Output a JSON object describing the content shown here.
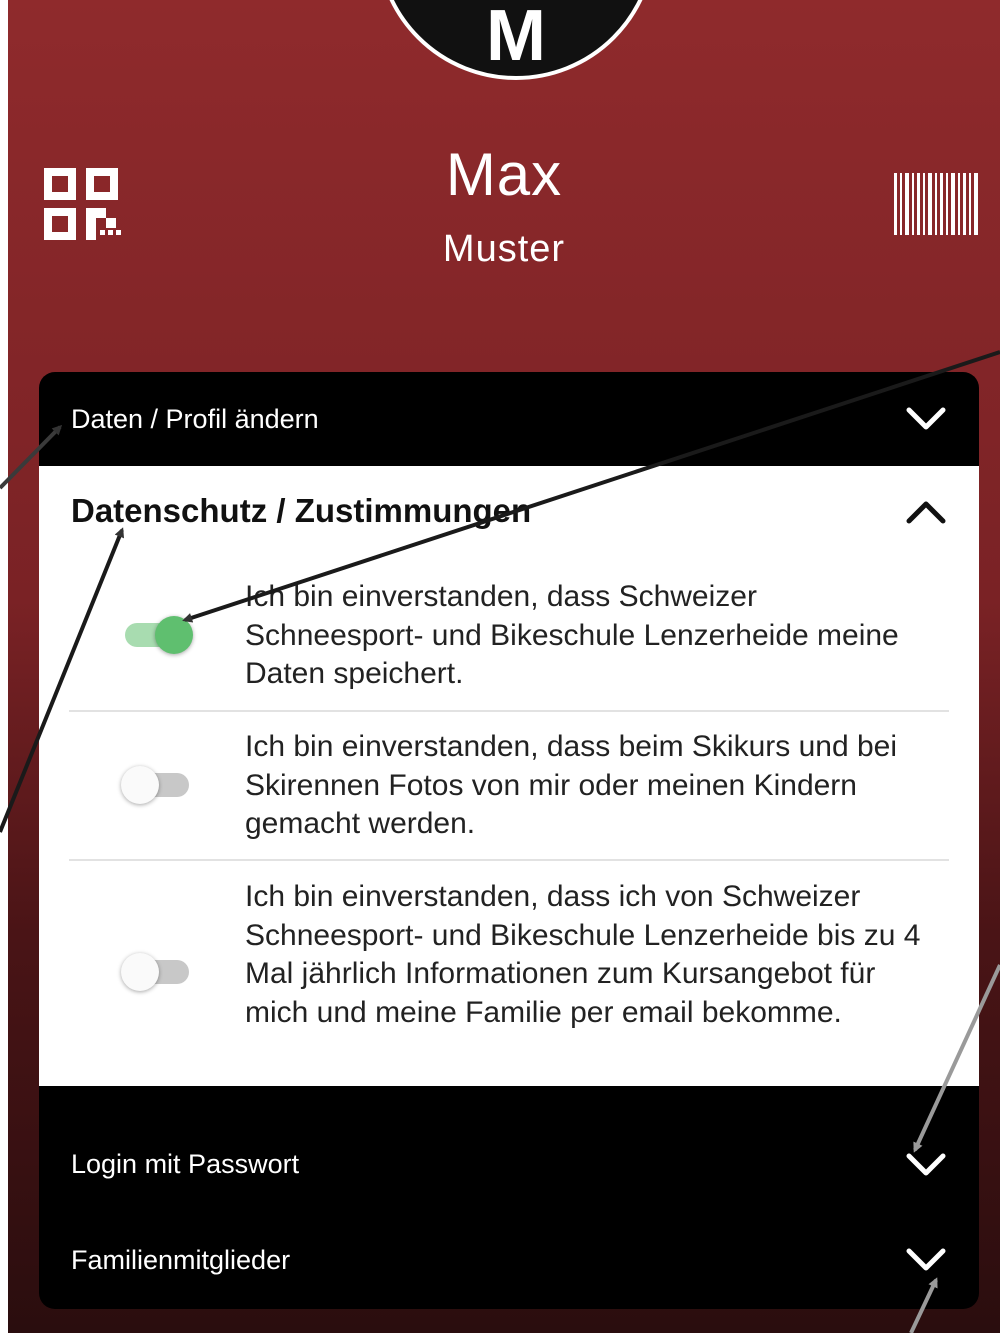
{
  "profile": {
    "avatar_letter": "M",
    "first_name": "Max",
    "last_name": "Muster",
    "qr_icon": "qr-code-icon",
    "barcode_icon": "barcode-icon"
  },
  "accordion": {
    "panel_profile": {
      "label": "Daten / Profil ändern",
      "expanded": false
    },
    "panel_privacy": {
      "label": "Datenschutz / Zustimmungen",
      "expanded": true,
      "consents": [
        {
          "text": "Ich bin einverstanden, dass Schweizer Schneesport- und Bikeschule Lenzerheide meine Daten speichert.",
          "checked": true
        },
        {
          "text": "Ich bin einverstanden, dass beim Skikurs und bei Skirennen Fotos von mir oder meinen Kindern gemacht werden.",
          "checked": false
        },
        {
          "text": "Ich bin einverstanden, dass ich von Schweizer Schneesport- und Bikeschule Lenzerheide bis zu 4 Mal jährlich Informationen zum Kursangebot für mich und meine Familie per email bekomme.",
          "checked": false
        }
      ]
    },
    "panel_login": {
      "label": "Login mit Passwort",
      "expanded": false
    },
    "panel_family": {
      "label": "Familienmitglieder",
      "expanded": false
    }
  },
  "colors": {
    "background_top": "#8f2a2c",
    "background_bottom": "#2a0d0e",
    "toggle_on": "#5fbf6f",
    "toggle_off": "#c8c8c8"
  }
}
